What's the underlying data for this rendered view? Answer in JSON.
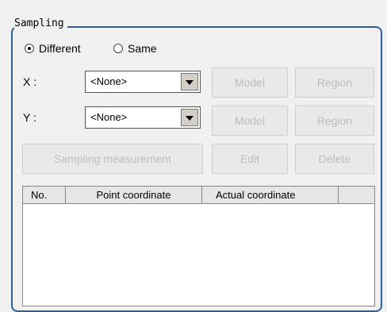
{
  "group": {
    "title": "Sampling"
  },
  "mode": {
    "options": [
      "Different",
      "Same"
    ],
    "selected": "Different"
  },
  "x_row": {
    "label": "X :",
    "value": "<None>",
    "model": "Model",
    "region": "Region"
  },
  "y_row": {
    "label": "Y :",
    "value": "<None>",
    "model": "Model",
    "region": "Region"
  },
  "actions": {
    "sampling": "Sampling measurement",
    "edit": "Edit",
    "delete": "Delete"
  },
  "table": {
    "columns": [
      "No.",
      "Point coordinate",
      "Actual coordinate",
      ""
    ],
    "rows": []
  },
  "colors": {
    "group_border": "#2f5f9a",
    "disabled_text": "#bdbdbd"
  }
}
